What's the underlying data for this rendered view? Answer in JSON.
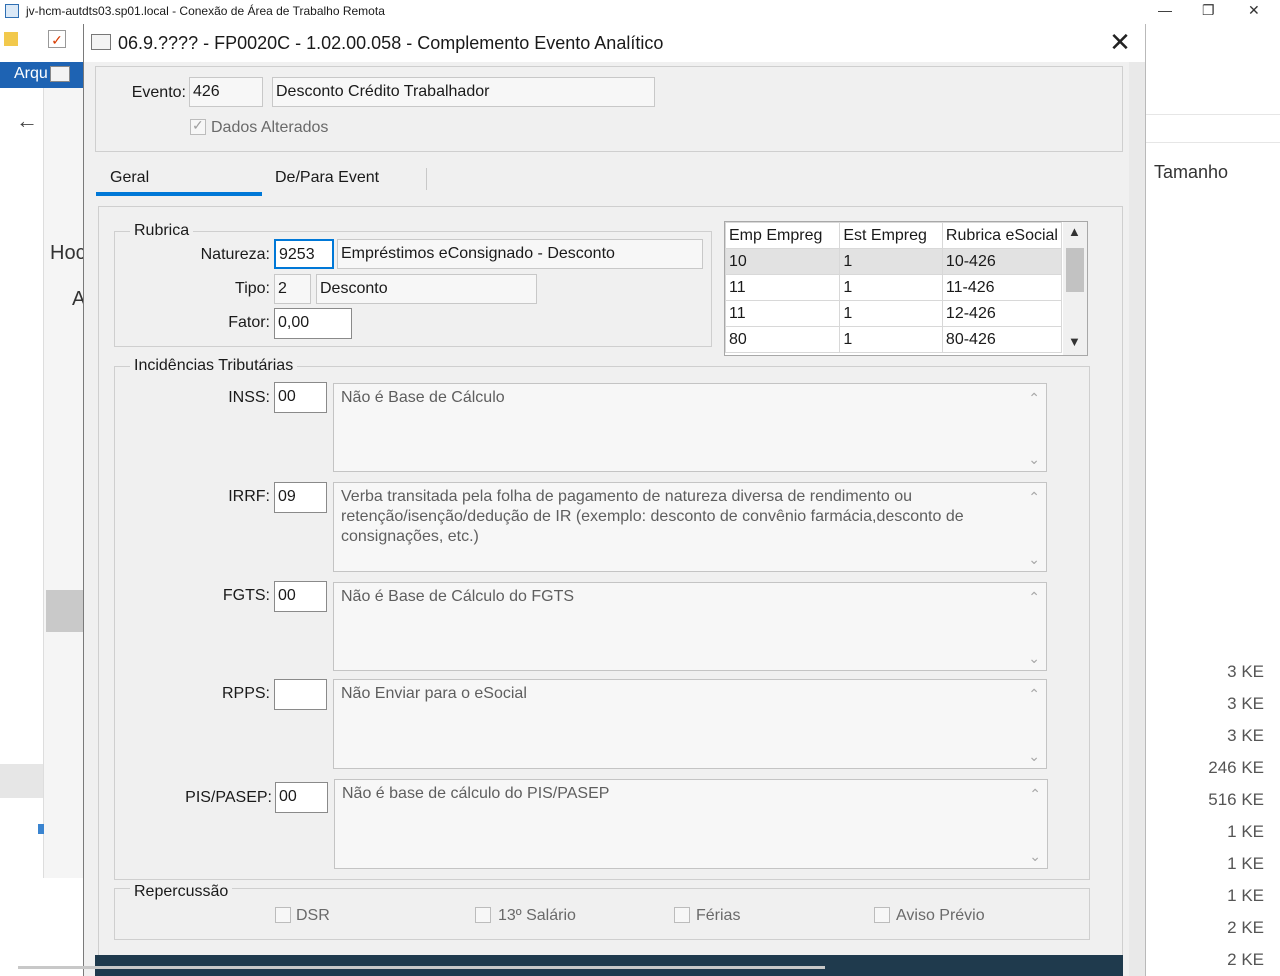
{
  "rdp": {
    "title": "jv-hcm-autdts03.sp01.local - Conexão de Área de Trabalho Remota",
    "minimize": "—",
    "restore": "❐",
    "close": "✕"
  },
  "background": {
    "menu_partial": "Arqu",
    "text_hod": "Hoc",
    "text_a": "A",
    "column_tamanho": "Tamanho",
    "sizes": [
      "3 KE",
      "3 KE",
      "3 KE",
      "246 KE",
      "516 KE",
      "1 KE",
      "1 KE",
      "1 KE",
      "2 KE",
      "2 KE"
    ]
  },
  "dialog": {
    "title": "06.9.???? - FP0020C - 1.02.00.058 - Complemento Evento Analítico",
    "close": "✕",
    "evento": {
      "label": "Evento:",
      "code": "426",
      "description": "Desconto Crédito Trabalhador",
      "dados_alterados": "Dados Alterados"
    },
    "tabs": [
      {
        "label": "Geral",
        "active": true
      },
      {
        "label": "De/Para Event",
        "active": false
      }
    ],
    "rubrica": {
      "group_title": "Rubrica",
      "natureza_label": "Natureza:",
      "natureza_code": "9253",
      "natureza_desc": "Empréstimos eConsignado - Desconto",
      "tipo_label": "Tipo:",
      "tipo_code": "2",
      "tipo_desc": "Desconto",
      "fator_label": "Fator:",
      "fator_value": "0,00"
    },
    "grid": {
      "columns": [
        "Emp Empreg",
        "Est Empreg",
        "Rubrica eSocial"
      ],
      "rows": [
        [
          "10",
          "1",
          "10-426"
        ],
        [
          "11",
          "1",
          "11-426"
        ],
        [
          "11",
          "1",
          "12-426"
        ],
        [
          "80",
          "1",
          "80-426"
        ]
      ]
    },
    "incidencias": {
      "group_title": "Incidências Tributárias",
      "items": [
        {
          "label": "INSS:",
          "code": "00",
          "text": "Não é Base de Cálculo"
        },
        {
          "label": "IRRF:",
          "code": "09",
          "text": "Verba transitada pela folha de pagamento de natureza diversa de rendimento ou retenção/isenção/dedução de IR (exemplo: desconto de convênio farmácia,desconto de consignações, etc.)"
        },
        {
          "label": "FGTS:",
          "code": "00",
          "text": "Não é Base de Cálculo do FGTS"
        },
        {
          "label": "RPPS:",
          "code": "",
          "text": "Não Enviar para o eSocial"
        },
        {
          "label": "PIS/PASEP:",
          "code": "00",
          "text": "Não é base de cálculo do PIS/PASEP"
        }
      ]
    },
    "repercussao": {
      "group_title": "Repercussão",
      "options": [
        "DSR",
        "13º Salário",
        "Férias",
        "Aviso Prévio"
      ]
    },
    "colors": {
      "tab_accent": "#0078d7",
      "footer_bar": "#1f3a4d"
    }
  }
}
